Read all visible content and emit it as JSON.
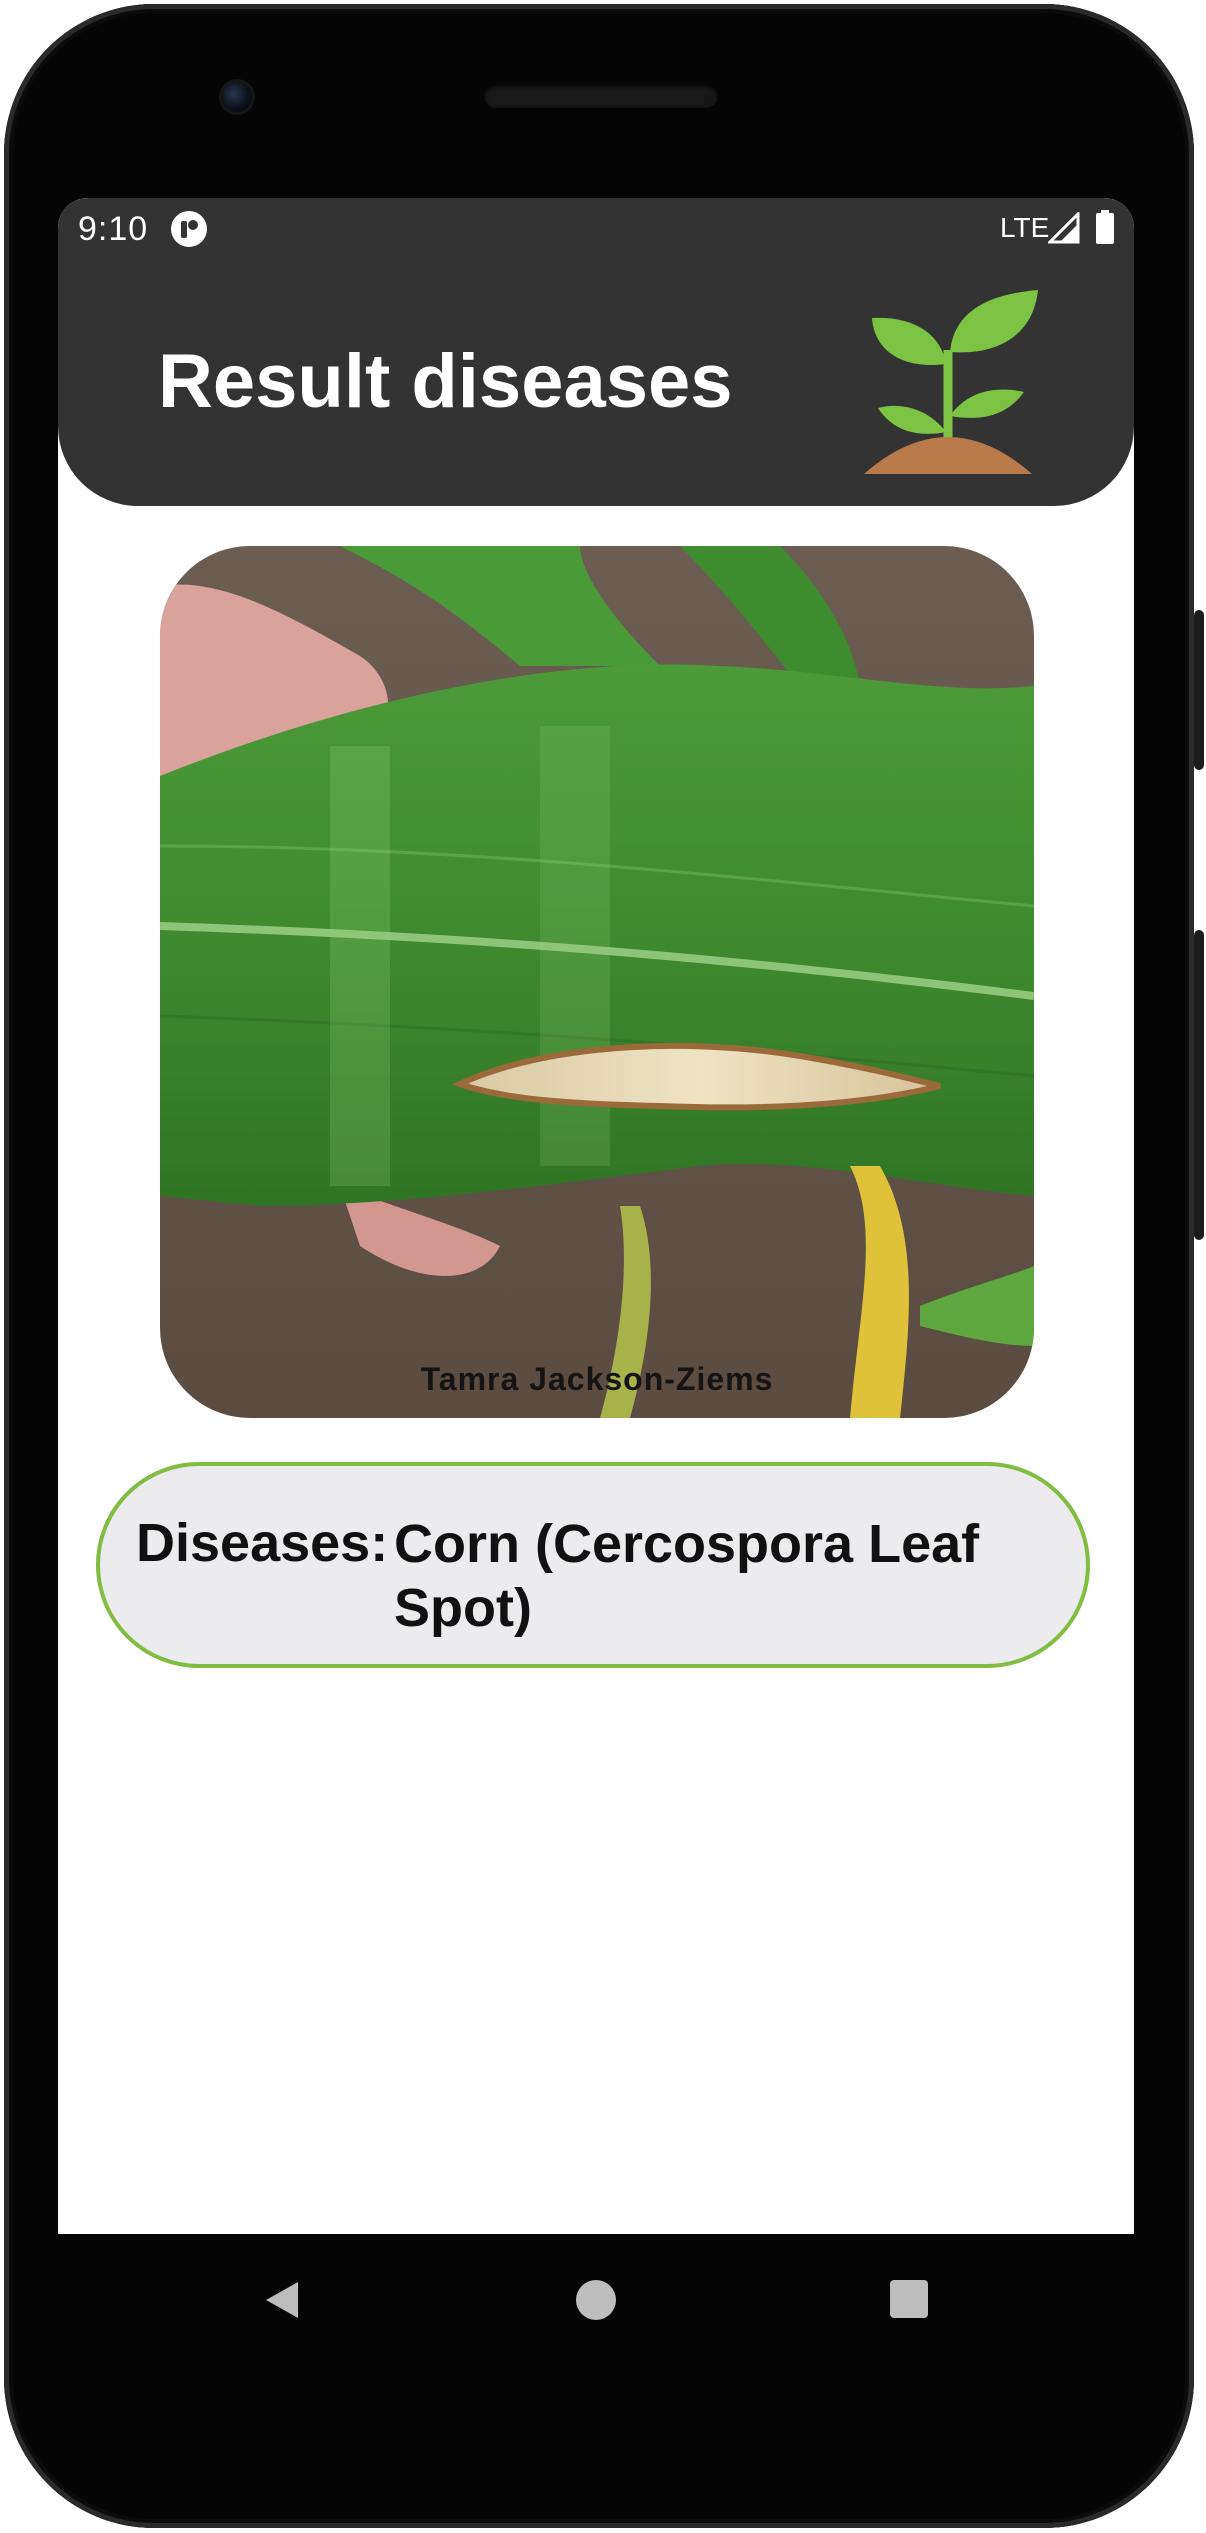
{
  "status_bar": {
    "time": "9:10",
    "network": "LTE",
    "icons": [
      "app-notification-icon",
      "cell-signal-icon",
      "battery-icon"
    ]
  },
  "header": {
    "title": "Result diseases",
    "logo_icon": "sprout-icon",
    "background_color": "#333333"
  },
  "image": {
    "subject": "corn leaf with lesion",
    "credit": "Tamra Jackson-Ziems"
  },
  "result": {
    "label": "Diseases:",
    "value": "Corn (Cercospora Leaf Spot)",
    "border_color": "#80bd41",
    "background_color": "#ececee"
  },
  "nav_bar": {
    "buttons": [
      "back-icon",
      "home-icon",
      "recents-icon"
    ]
  }
}
